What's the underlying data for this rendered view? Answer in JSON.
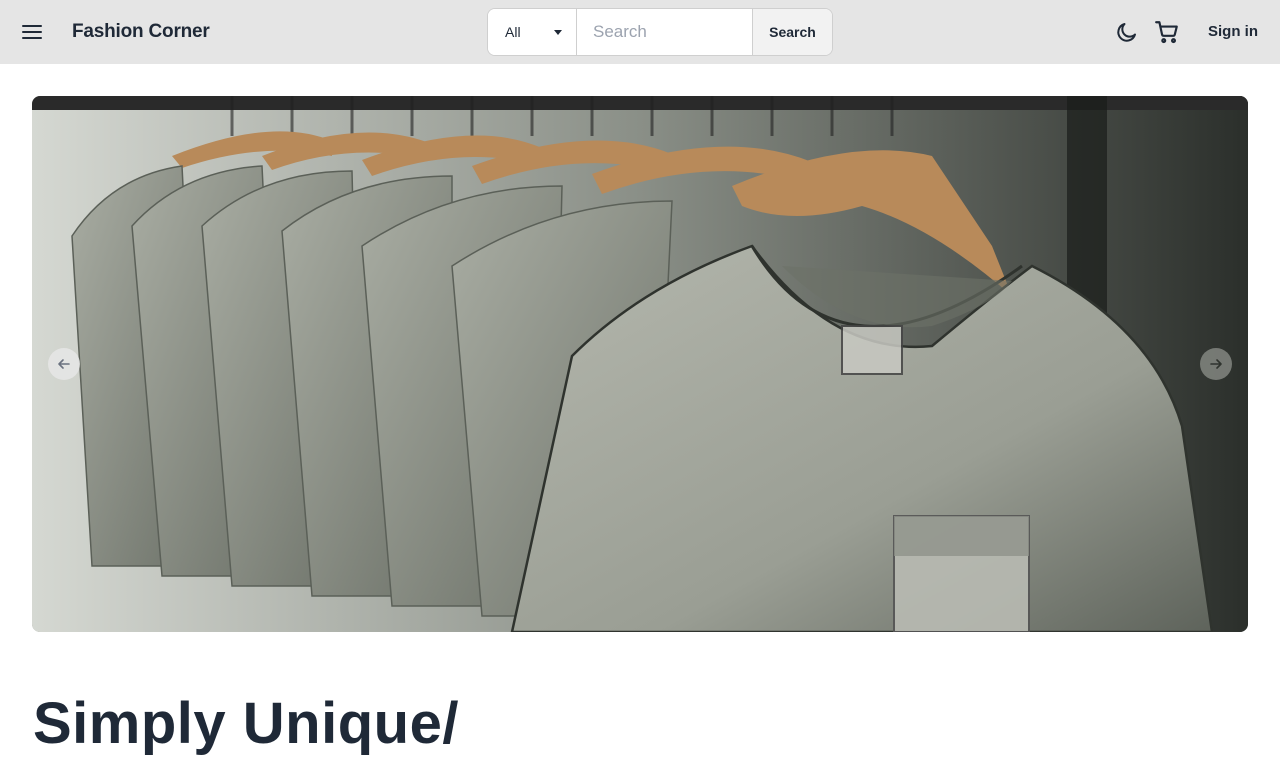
{
  "header": {
    "brand": "Fashion Corner",
    "signin_label": "Sign in"
  },
  "search": {
    "category_selected": "All",
    "placeholder": "Search",
    "value": "",
    "button_label": "Search"
  },
  "icons": {
    "menu": "hamburger-menu-icon",
    "theme": "moon-icon",
    "cart": "shopping-cart-icon",
    "prev": "arrow-left-icon",
    "next": "arrow-right-icon"
  },
  "hero": {
    "headline": "Simply Unique/"
  },
  "colors": {
    "navbar_bg": "#e5e5e5",
    "text": "#1f2937"
  }
}
